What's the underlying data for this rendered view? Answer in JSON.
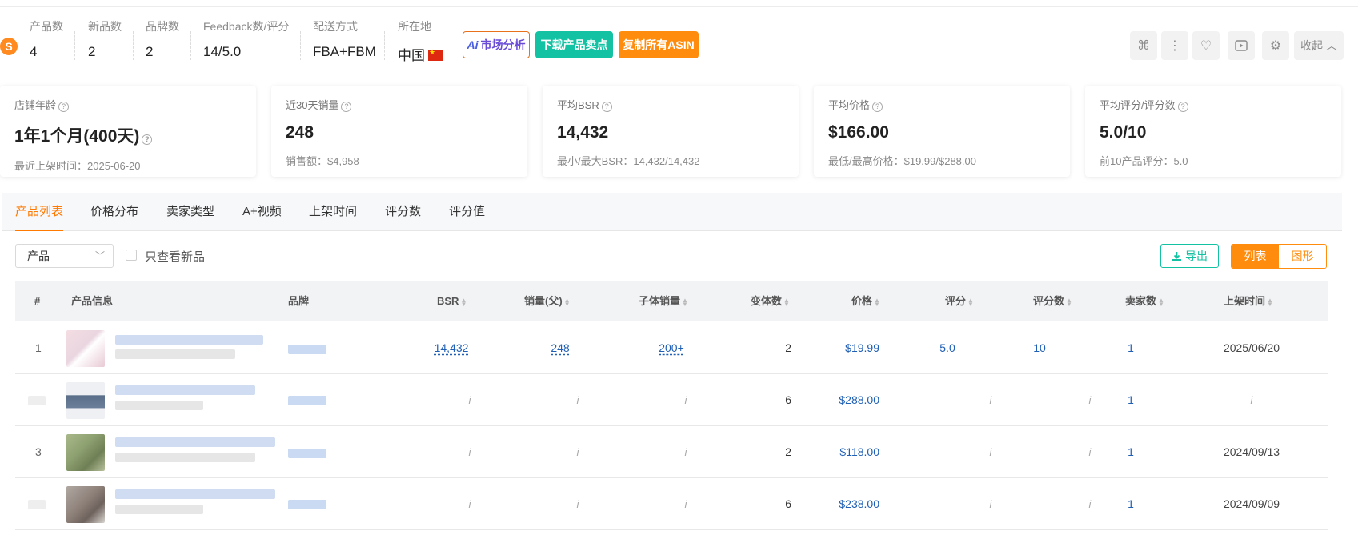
{
  "header": {
    "logo": "S",
    "stats": [
      {
        "label": "产品数",
        "value": "4"
      },
      {
        "label": "新品数",
        "value": "2"
      },
      {
        "label": "品牌数",
        "value": "2"
      },
      {
        "label": "Feedback数/评分",
        "value": "14/5.0"
      },
      {
        "label": "配送方式",
        "value": "FBA+FBM"
      },
      {
        "label": "所在地",
        "value": "中国"
      }
    ],
    "btn_ai_prefix": "Ai",
    "btn_ai": "市场分析",
    "btn_download": "下载产品卖点",
    "btn_copy": "复制所有ASIN",
    "collapse": "收起"
  },
  "cards": [
    {
      "title": "店铺年龄",
      "value": "1年1个月(400天)",
      "sub": "最近上架时间：2025-06-20"
    },
    {
      "title": "近30天销量",
      "value": "248",
      "sub": "销售额：$4,958"
    },
    {
      "title": "平均BSR",
      "value": "14,432",
      "sub": "最小/最大BSR：14,432/14,432"
    },
    {
      "title": "平均价格",
      "value": "$166.00",
      "sub": "最低/最高价格：$19.99/$288.00"
    },
    {
      "title": "平均评分/评分数",
      "value": "5.0/10",
      "sub": "前10产品评分：5.0"
    }
  ],
  "tabs": [
    "产品列表",
    "价格分布",
    "卖家类型",
    "A+视频",
    "上架时间",
    "评分数",
    "评分值"
  ],
  "filter": {
    "select": "产品",
    "only_new": "只查看新品",
    "export": "导出",
    "view_list": "列表",
    "view_chart": "图形"
  },
  "table": {
    "columns": [
      "#",
      "产品信息",
      "品牌",
      "BSR",
      "销量(父)",
      "子体销量",
      "变体数",
      "价格",
      "评分",
      "评分数",
      "卖家数",
      "上架时间"
    ],
    "rows": [
      {
        "idx": "1",
        "bsr": "14,432",
        "sales": "248",
        "child_sales": "200+",
        "variants": "2",
        "price": "$19.99",
        "rating": "5.0",
        "reviews": "10",
        "sellers": "1",
        "date": "2025/06/20"
      },
      {
        "idx": "",
        "bsr": "i",
        "sales": "i",
        "child_sales": "i",
        "variants": "6",
        "price": "$288.00",
        "rating": "i",
        "reviews": "i",
        "sellers": "1",
        "date": "i"
      },
      {
        "idx": "3",
        "bsr": "i",
        "sales": "i",
        "child_sales": "i",
        "variants": "2",
        "price": "$118.00",
        "rating": "i",
        "reviews": "i",
        "sellers": "1",
        "date": "2024/09/13"
      },
      {
        "idx": "",
        "bsr": "i",
        "sales": "i",
        "child_sales": "i",
        "variants": "6",
        "price": "$238.00",
        "rating": "i",
        "reviews": "i",
        "sellers": "1",
        "date": "2024/09/09"
      }
    ]
  }
}
